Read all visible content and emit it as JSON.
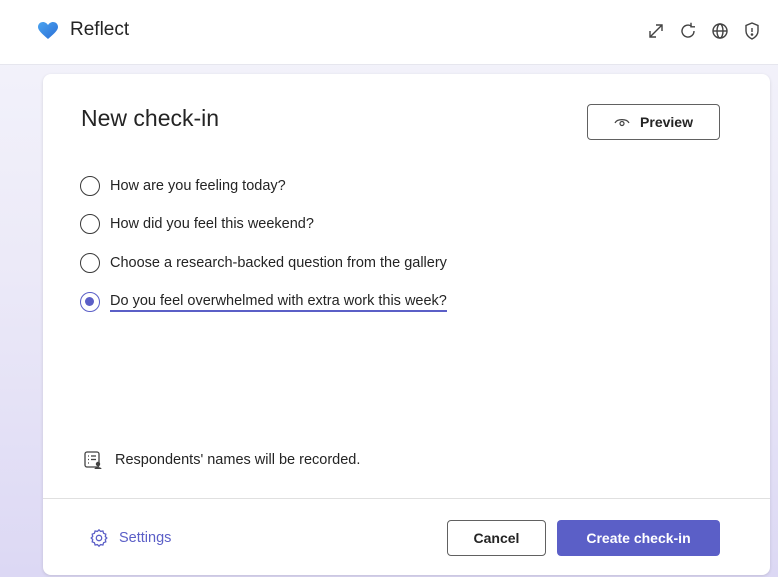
{
  "app": {
    "title": "Reflect",
    "logo_icon": "heart-icon",
    "window_icons": [
      "expand-icon",
      "refresh-icon",
      "globe-icon",
      "shield-icon"
    ]
  },
  "card": {
    "title": "New check-in",
    "preview_label": "Preview",
    "questions": [
      {
        "label": "How are you feeling today?",
        "selected": false
      },
      {
        "label": "How did you feel this weekend?",
        "selected": false
      },
      {
        "label": "Choose a research-backed question from the gallery",
        "selected": false
      },
      {
        "label": "Do you feel overwhelmed with extra work this week?",
        "selected": true
      }
    ],
    "notice": "Respondents' names will be recorded.",
    "settings_label": "Settings",
    "cancel_label": "Cancel",
    "create_label": "Create check-in"
  },
  "colors": {
    "accent": "#5b5fc7",
    "logo_blue": "#2f7fe0",
    "text": "#242424"
  }
}
